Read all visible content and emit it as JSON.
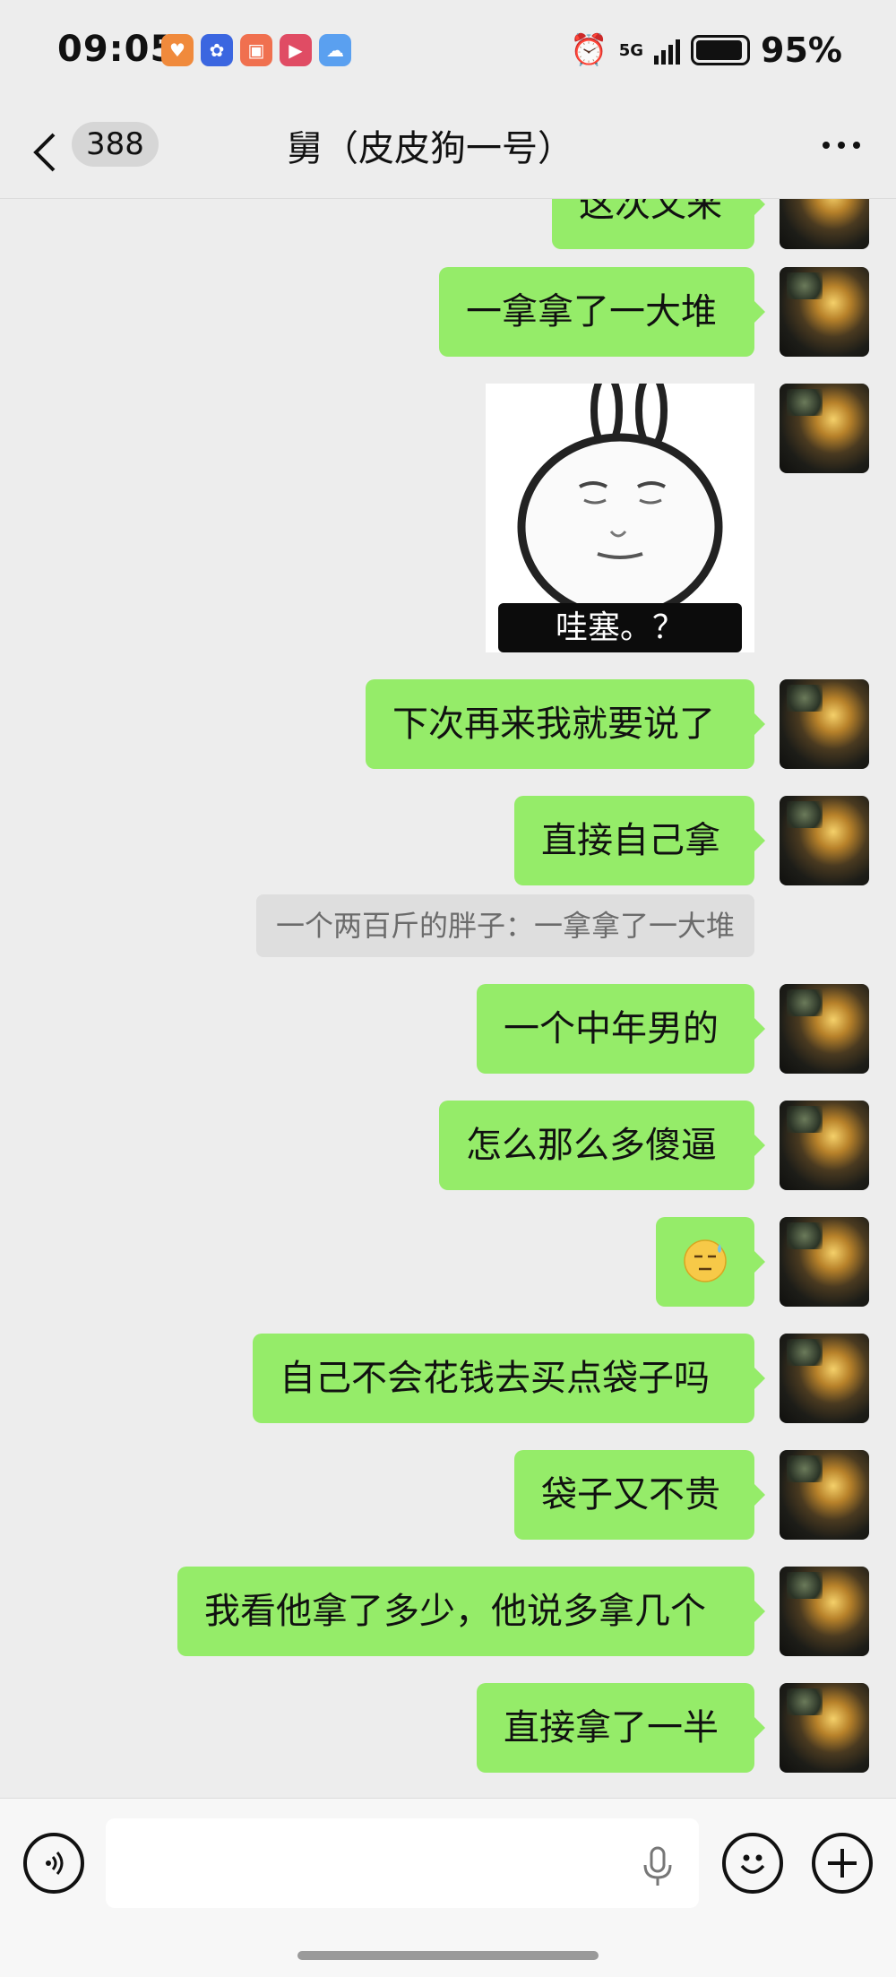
{
  "status_bar": {
    "time": "09:05",
    "network": "5G",
    "battery": "95%",
    "battery_level": 0.95,
    "app_icons": [
      {
        "name": "heart-app",
        "color": "#f08a3c"
      },
      {
        "name": "flower-app",
        "color": "#3b66e0"
      },
      {
        "name": "taobao-app",
        "color": "#f0704f"
      },
      {
        "name": "video-app",
        "color": "#e04c64"
      },
      {
        "name": "weather-app",
        "color": "#5aa0f0"
      }
    ]
  },
  "header": {
    "back_icon": "chevron-left-icon",
    "unread_count": "388",
    "title": "舅（皮皮狗一号）",
    "more_icon": "more-dots-icon"
  },
  "messages": [
    {
      "type": "text",
      "text": "这次又来"
    },
    {
      "type": "text",
      "text": "一拿拿了一大堆"
    },
    {
      "type": "sticker",
      "caption": "哇塞。？"
    },
    {
      "type": "text",
      "text": "下次再来我就要说了"
    },
    {
      "type": "text",
      "text": "直接自己拿"
    },
    {
      "type": "quote",
      "text": "一个两百斤的胖子：一拿拿了一大堆"
    },
    {
      "type": "text",
      "text": "一个中年男的"
    },
    {
      "type": "text",
      "text": "怎么那么多傻逼"
    },
    {
      "type": "emoji",
      "icon": "sweat-face-emoji"
    },
    {
      "type": "text",
      "text": "自己不会花钱去买点袋子吗"
    },
    {
      "type": "text",
      "text": "袋子又不贵"
    },
    {
      "type": "text",
      "text": "我看他拿了多少，他说多拿几个"
    },
    {
      "type": "text",
      "text": "直接拿了一半"
    }
  ],
  "input_bar": {
    "voice_icon": "voice-icon",
    "input_value": "",
    "mic_icon": "microphone-icon",
    "emoji_icon": "emoji-icon",
    "plus_icon": "plus-icon"
  },
  "colors": {
    "background": "#ededed",
    "bubble_self": "#95ec69",
    "quote_bg": "#dedede"
  }
}
